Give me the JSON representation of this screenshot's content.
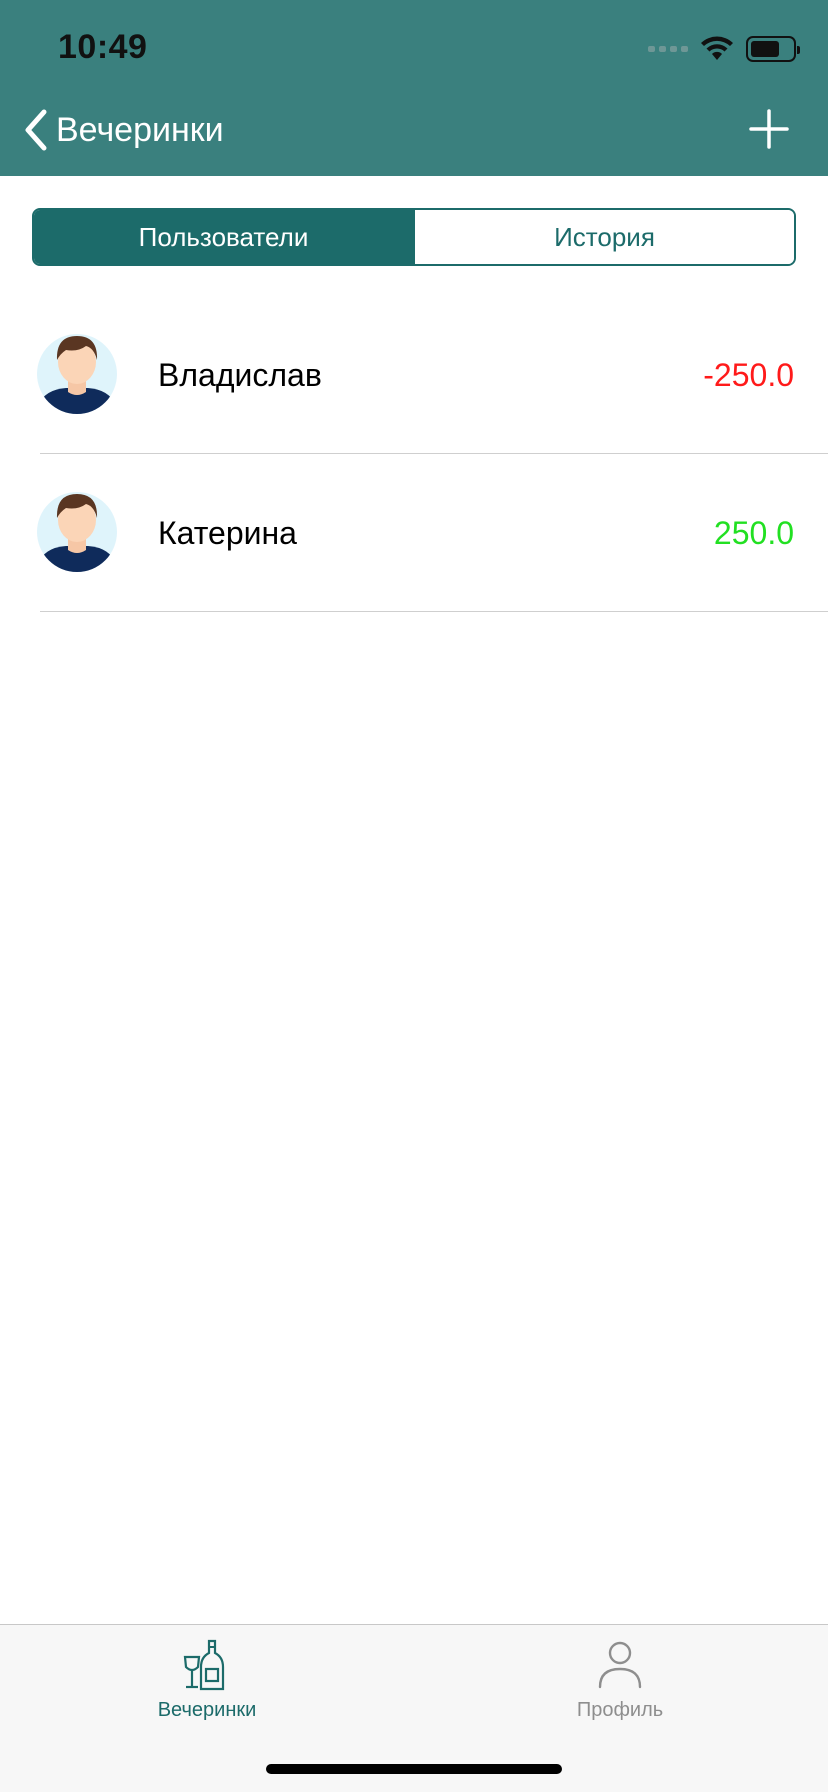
{
  "status_bar": {
    "time": "10:49"
  },
  "nav": {
    "back_label": "Вечеринки"
  },
  "segmented": {
    "users_label": "Пользователи",
    "history_label": "История"
  },
  "users": [
    {
      "name": "Владислав",
      "amount": "-250.0",
      "amount_color": "#ff1a1a"
    },
    {
      "name": "Катерина",
      "amount": "250.0",
      "amount_color": "#22e022"
    }
  ],
  "tabbar": {
    "parties_label": "Вечеринки",
    "profile_label": "Профиль",
    "active_color": "#1c6b6a",
    "inactive_color": "#8e8e8e"
  },
  "colors": {
    "accent": "#3a807e",
    "accent_dark": "#1c6b6a"
  }
}
